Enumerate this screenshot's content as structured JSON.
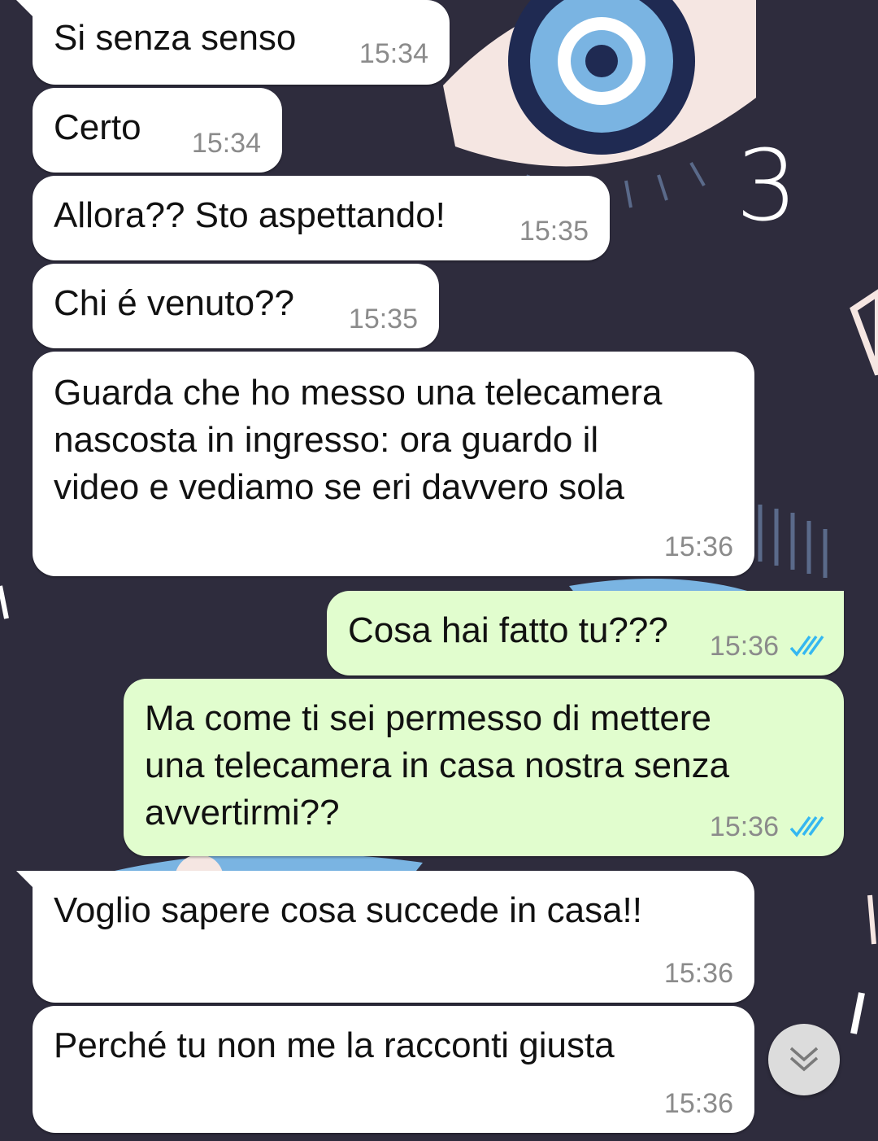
{
  "annotation": "3",
  "messages": [
    {
      "text": "Si senza senso",
      "time": "15:34"
    },
    {
      "text": "Certo",
      "time": "15:34"
    },
    {
      "text": "Allora?? Sto aspettando!",
      "time": "15:35"
    },
    {
      "text": "Chi é venuto??",
      "time": "15:35"
    },
    {
      "text": "Guarda che ho messo una telecamera\nnascosta in ingresso: ora guardo il\nvideo e vediamo se eri davvero sola",
      "time": "15:36"
    },
    {
      "text": "Cosa hai fatto tu???",
      "time": "15:36"
    },
    {
      "text": "Ma come ti sei permesso di mettere\nuna telecamera in casa nostra senza\navvertirmi??",
      "time": "15:36"
    },
    {
      "text": "Voglio sapere cosa succede in casa!!",
      "time": "15:36"
    },
    {
      "text": "Perché tu non me la racconti giusta",
      "time": "15:36"
    }
  ],
  "colors": {
    "incoming": "#ffffff",
    "outgoing": "#e1fdce",
    "read_ticks": "#34b7f1",
    "background": "#2e2c3d"
  },
  "icons": {
    "read_receipt": "double-check-icon",
    "scroll_down": "double-chevron-down-icon"
  }
}
